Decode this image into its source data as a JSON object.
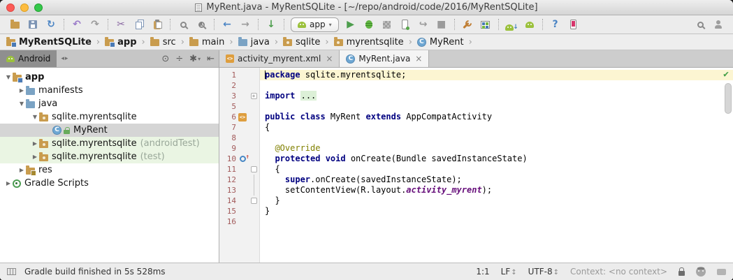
{
  "window": {
    "title": "MyRent.java - MyRentSQLite - [~/repo/android/code/2016/MyRentSQLite]"
  },
  "toolbar": {
    "run_config_label": "app",
    "groups": [
      [
        "open",
        "save",
        "sync"
      ],
      [
        "undo",
        "redo"
      ],
      [
        "cut",
        "copy",
        "paste"
      ],
      [
        "find",
        "replace"
      ],
      [
        "back",
        "forward"
      ],
      [
        "vcs-update"
      ],
      [
        "run-config",
        "run",
        "debug",
        "coverage",
        "run-device",
        "attach-debugger",
        "stop"
      ],
      [
        "sync-gradle",
        "avd-manager"
      ],
      [
        "sdk-manager",
        "device-monitor"
      ],
      [
        "help",
        "connected-devices"
      ]
    ],
    "right_icons": [
      "search",
      "user"
    ]
  },
  "breadcrumbs": [
    {
      "label": "MyRentSQLite",
      "icon": "project-folder",
      "bold": true
    },
    {
      "label": "app",
      "icon": "app-folder",
      "bold": true
    },
    {
      "label": "src",
      "icon": "folder"
    },
    {
      "label": "main",
      "icon": "folder"
    },
    {
      "label": "java",
      "icon": "folder-blue"
    },
    {
      "label": "sqlite",
      "icon": "package"
    },
    {
      "label": "myrentsqlite",
      "icon": "package"
    },
    {
      "label": "MyRent",
      "icon": "class"
    }
  ],
  "tool_window": {
    "title": "Android",
    "icons": [
      "navigate",
      "collapse-all",
      "settings",
      "hide"
    ]
  },
  "tabs": [
    {
      "label": "activity_myrent.xml",
      "icon": "xml-file",
      "active": false
    },
    {
      "label": "MyRent.java",
      "icon": "class",
      "active": true
    }
  ],
  "project_tree": [
    {
      "label": "app",
      "level": 0,
      "arrow": "expanded",
      "icon": "app-folder",
      "bold": true
    },
    {
      "label": "manifests",
      "level": 1,
      "arrow": "collapsed",
      "icon": "folder-blue"
    },
    {
      "label": "java",
      "level": 1,
      "arrow": "expanded",
      "icon": "folder-blue"
    },
    {
      "label": "sqlite.myrentsqlite",
      "level": 2,
      "arrow": "expanded",
      "icon": "package"
    },
    {
      "label": "MyRent",
      "level": 3,
      "icon": "class",
      "icon2": "lock",
      "selected": true
    },
    {
      "label": "sqlite.myrentsqlite",
      "suffix": "(androidTest)",
      "level": 2,
      "arrow": "collapsed",
      "icon": "package",
      "test": true
    },
    {
      "label": "sqlite.myrentsqlite",
      "suffix": "(test)",
      "level": 2,
      "arrow": "collapsed",
      "icon": "package",
      "test": true
    },
    {
      "label": "res",
      "level": 1,
      "arrow": "collapsed",
      "icon": "res-folder"
    },
    {
      "label": "Gradle Scripts",
      "level": 0,
      "arrow": "collapsed",
      "icon": "gradle"
    }
  ],
  "editor": {
    "inspection_status": "ok",
    "lines": [
      {
        "num": "1",
        "caret": true,
        "tokens": [
          {
            "c": "kw",
            "t": "package"
          },
          {
            "t": " sqlite.myrentsqlite;"
          }
        ]
      },
      {
        "num": "2",
        "tokens": []
      },
      {
        "num": "3",
        "fold": "plus",
        "tokens": [
          {
            "c": "kw",
            "t": "import"
          },
          {
            "t": " "
          },
          {
            "c": "fold",
            "t": "..."
          }
        ]
      },
      {
        "num": "5",
        "tokens": []
      },
      {
        "num": "6",
        "gicon": "xml-file",
        "tokens": [
          {
            "c": "kw",
            "t": "public class"
          },
          {
            "t": " MyRent "
          },
          {
            "c": "kw",
            "t": "extends"
          },
          {
            "t": " AppCompatActivity"
          }
        ]
      },
      {
        "num": "7",
        "tokens": [
          {
            "t": "{"
          }
        ]
      },
      {
        "num": "8",
        "tokens": []
      },
      {
        "num": "9",
        "tokens": [
          {
            "t": "  "
          },
          {
            "c": "ann",
            "t": "@Override"
          }
        ]
      },
      {
        "num": "10",
        "gicon": "override",
        "tokens": [
          {
            "t": "  "
          },
          {
            "c": "kw",
            "t": "protected void"
          },
          {
            "t": " onCreate(Bundle savedInstanceState)"
          }
        ]
      },
      {
        "num": "11",
        "fold": "start",
        "tokens": [
          {
            "t": "  {"
          }
        ]
      },
      {
        "num": "12",
        "fold": "mid",
        "tokens": [
          {
            "t": "    "
          },
          {
            "c": "kw",
            "t": "super"
          },
          {
            "t": ".onCreate(savedInstanceState);"
          }
        ]
      },
      {
        "num": "13",
        "fold": "mid",
        "tokens": [
          {
            "t": "    setContentView(R.layout."
          },
          {
            "c": "field",
            "t": "activity_myrent"
          },
          {
            "t": ");"
          }
        ]
      },
      {
        "num": "14",
        "fold": "end",
        "tokens": [
          {
            "t": "  }"
          }
        ]
      },
      {
        "num": "15",
        "tokens": [
          {
            "t": "}"
          }
        ]
      },
      {
        "num": "16",
        "tokens": []
      }
    ]
  },
  "statusbar": {
    "message": "Gradle build finished in 5s 528ms",
    "position": "1:1",
    "line_ending": "LF",
    "encoding": "UTF-8",
    "context": "Context: <no context>",
    "right_icons": [
      "unlock",
      "inspections-profile",
      "feedback-bubble"
    ]
  }
}
